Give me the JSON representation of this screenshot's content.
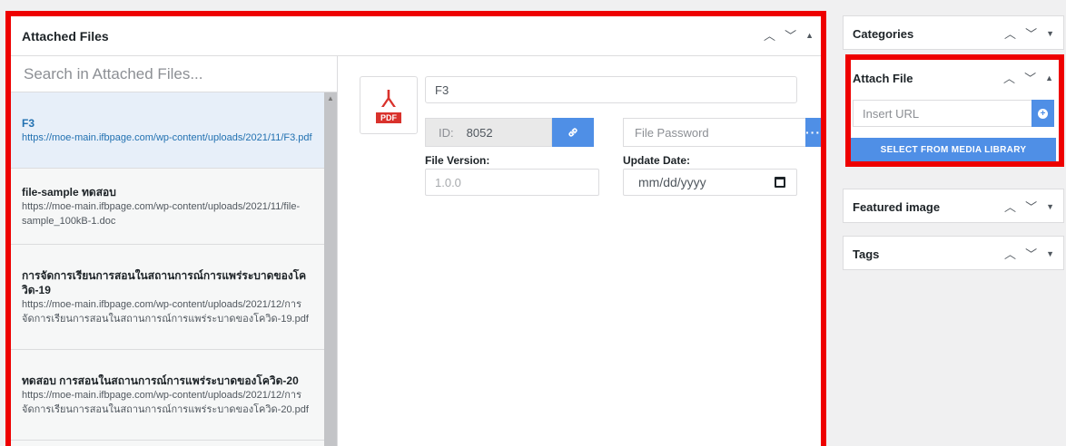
{
  "attached_files": {
    "title": "Attached Files",
    "search_placeholder": "Search in Attached Files...",
    "files": [
      {
        "name": "F3",
        "url": "https://moe-main.ifbpage.com/wp-content/uploads/2021/11/F3.pdf",
        "active": true
      },
      {
        "name": "file-sample ทดสอบ",
        "url": "https://moe-main.ifbpage.com/wp-content/uploads/2021/11/file-sample_100kB-1.doc",
        "active": false
      },
      {
        "name": "การจัดการเรียนการสอนในสถานการณ์การแพร่ระบาดของโควิด-19",
        "url": "https://moe-main.ifbpage.com/wp-content/uploads/2021/12/การจัดการเรียนการสอนในสถานการณ์การแพร่ระบาดของโควิด-19.pdf",
        "active": false
      },
      {
        "name": "ทดสอบ การสอนในสถานการณ์การแพร่ระบาดของโควิด-20",
        "url": "https://moe-main.ifbpage.com/wp-content/uploads/2021/12/การจัดการเรียนการสอนในสถานการณ์การแพร่ระบาดของโควิด-20.pdf",
        "active": false
      }
    ],
    "detail": {
      "pdf_label": "PDF",
      "file_name_value": "F3",
      "id_label": "ID:",
      "id_value": "8052",
      "password_placeholder": "File Password",
      "version_label": "File Version:",
      "version_placeholder": "1.0.0",
      "update_date_label": "Update Date:",
      "update_date_placeholder": "mm/dd/yyyy"
    }
  },
  "sidebar": {
    "categories_title": "Categories",
    "attach_file": {
      "title": "Attach File",
      "url_placeholder": "Insert URL",
      "media_button": "SELECT FROM MEDIA LIBRARY"
    },
    "featured_image_title": "Featured image",
    "tags_title": "Tags"
  },
  "colors": {
    "highlight_border": "#ee0000",
    "button_blue": "#4f8fe6",
    "pdf_red": "#d9322c"
  }
}
